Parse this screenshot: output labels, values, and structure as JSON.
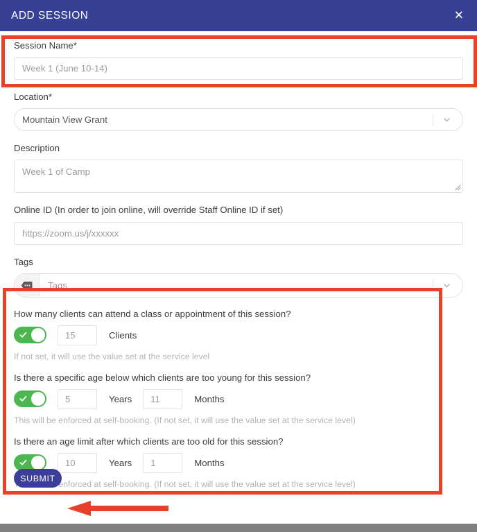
{
  "header": {
    "title": "ADD SESSION",
    "close_label": "✕"
  },
  "form": {
    "session_name": {
      "label": "Session Name*",
      "value": "Week 1 (June 10-14)",
      "placeholder": "Week 1 (June 10-14)"
    },
    "location": {
      "label": "Location*",
      "value": "Mountain View Grant"
    },
    "description": {
      "label": "Description",
      "value": "Week 1 of Camp",
      "placeholder": "Week 1 of Camp"
    },
    "online_id": {
      "label": "Online ID (In order to join online, will override Staff Online ID if set)",
      "value": "",
      "placeholder": "https://zoom.us/j/xxxxxx"
    },
    "tags": {
      "label": "Tags",
      "value": "",
      "placeholder": "Tags",
      "icon": "tag-icon"
    },
    "capacity": {
      "question": "How many clients can attend a class or appointment of this session?",
      "toggle_on": true,
      "value": "15",
      "unit": "Clients",
      "helper": "If not set, it will use the value set at the service level"
    },
    "min_age": {
      "question": "Is there a specific age below which clients are too young for this session?",
      "toggle_on": true,
      "years": "5",
      "years_unit": "Years",
      "months": "11",
      "months_unit": "Months",
      "helper": "This will be enforced at self-booking. (If not set, it will use the value set at the service level)"
    },
    "max_age": {
      "question": "Is there an age limit after which clients are too old for this session?",
      "toggle_on": true,
      "years": "10",
      "years_unit": "Years",
      "months": "1",
      "months_unit": "Months",
      "helper": "This will be enforced at self-booking. (If not set, it will use the value set at the service level)"
    },
    "submit_label": "SUBMIT"
  },
  "colors": {
    "header_blue": "#364196",
    "submit_blue": "#3b3f99",
    "toggle_green": "#4cb74f",
    "annotation_red": "#e8412a",
    "footer_grey": "#808080"
  }
}
